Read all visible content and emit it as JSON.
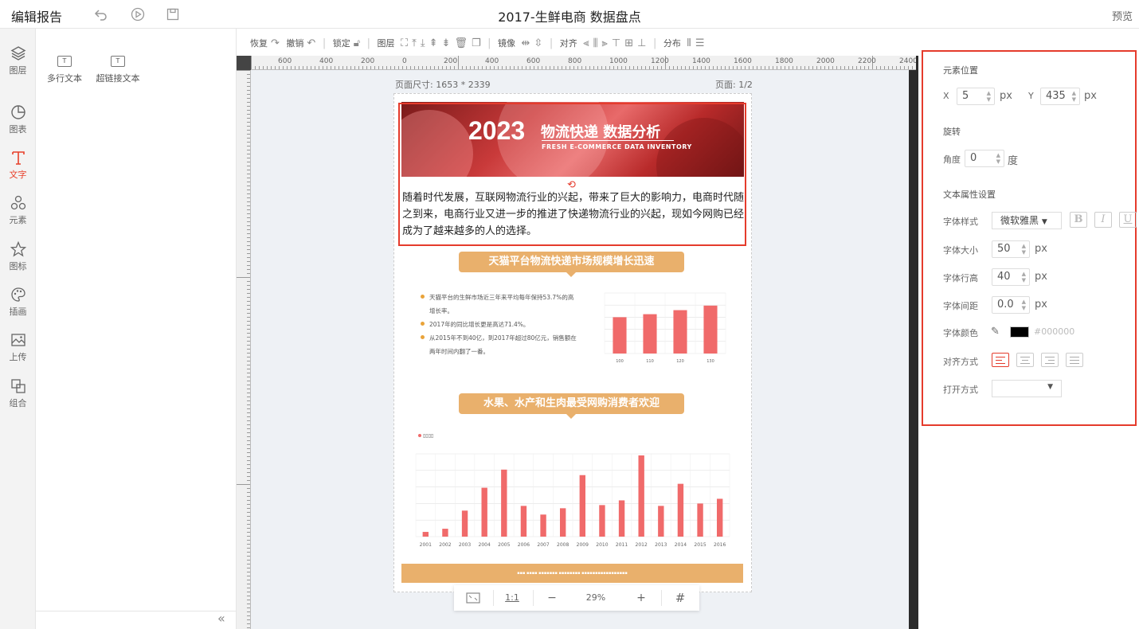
{
  "topbar": {
    "title": "编辑报告",
    "doc_title": "2017-生鲜电商 数据盘点",
    "preview": "预览"
  },
  "leftbar": [
    {
      "label": "图层",
      "icon": "layers-icon"
    },
    {
      "label": "图表",
      "icon": "pie-chart-icon"
    },
    {
      "label": "文字",
      "icon": "text-icon"
    },
    {
      "label": "元素",
      "icon": "shapes-icon"
    },
    {
      "label": "图标",
      "icon": "star-icon"
    },
    {
      "label": "插画",
      "icon": "palette-icon"
    },
    {
      "label": "上传",
      "icon": "upload-image-icon"
    },
    {
      "label": "组合",
      "icon": "group-icon"
    }
  ],
  "panel": {
    "tools": [
      "多行文本",
      "超链接文本"
    ]
  },
  "toolbar": {
    "redo": "恢复",
    "undo": "撤销",
    "lock": "锁定",
    "layer": "图层",
    "mirror": "镜像",
    "align": "对齐",
    "distribute": "分布"
  },
  "ruler": {
    "h_labels": [
      "600",
      "400",
      "200",
      "0",
      "200",
      "400",
      "600",
      "800",
      "1000",
      "1200",
      "1400",
      "1600",
      "1800",
      "2000",
      "2200",
      "2400"
    ]
  },
  "canvas": {
    "page_size": "页面尺寸: 1653 * 2339",
    "page_num": "页面: 1/2",
    "hero_year": "2023",
    "hero_title": "物流快递 数据分析",
    "hero_subtitle": "FRESH E-COMMERCE DATA INVENTORY",
    "body_text": "随着时代发展，互联网物流行业的兴起，带来了巨大的影响力，电商时代随之到来，电商行业又进一步的推进了快递物流行业的兴起，现如今网购已经成为了越来越多的人的选择。",
    "banner1": "天猫平台物流快递市场规模增长迅速",
    "bullets": [
      "天猫平台的生鲜市场近三年来平均每年保持53.7%的高增长率。",
      "2017年的同比增长更是高达71.4%。",
      "从2015年不到40亿，到2017年超过80亿元，销售额在两年时间内翻了一番。"
    ],
    "banner2": "水果、水产和生肉最受网购消费者欢迎"
  },
  "chart_data": [
    {
      "type": "bar",
      "categories": [
        "100",
        "110",
        "120",
        "130"
      ],
      "values": [
        72,
        78,
        86,
        95
      ],
      "ylim": [
        0,
        120
      ],
      "colors": [
        "#f06a6a"
      ]
    },
    {
      "type": "bar",
      "categories": [
        "2001",
        "2002",
        "2003",
        "2004",
        "2005",
        "2006",
        "2007",
        "2008",
        "2009",
        "2010",
        "2011",
        "2012",
        "2013",
        "2014",
        "2015",
        "2016"
      ],
      "values": [
        6,
        10,
        33,
        62,
        85,
        39,
        28,
        36,
        78,
        40,
        46,
        103,
        39,
        67,
        42,
        48
      ],
      "ylim": [
        0,
        105
      ],
      "colors": [
        "#f06a6a"
      ]
    }
  ],
  "zoombar": {
    "ratio": "1:1",
    "minus": "−",
    "zoom": "29%",
    "plus": "+"
  },
  "props": {
    "pos_title": "元素位置",
    "x_label": "X",
    "x": "5",
    "y_label": "Y",
    "y": "435",
    "unit_px": "px",
    "rot_title": "旋转",
    "angle_label": "角度",
    "angle": "0",
    "deg": "度",
    "text_title": "文本属性设置",
    "font_style_label": "字体样式",
    "font_style": "微软雅黑",
    "bold": "B",
    "italic": "I",
    "underline": "U",
    "size_label": "字体大小",
    "size": "50",
    "line_height_label": "字体行高",
    "line_height": "40",
    "spacing_label": "字体间距",
    "spacing": "0.0",
    "color_label": "字体颜色",
    "color_hex": "#000000",
    "align_label": "对齐方式",
    "open_label": "打开方式"
  }
}
